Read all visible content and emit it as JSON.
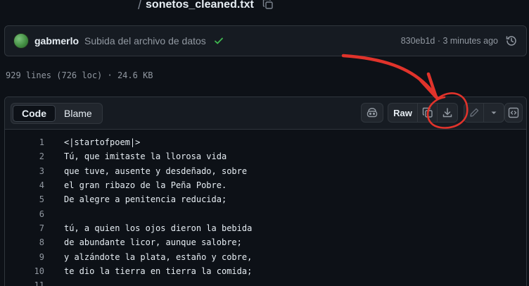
{
  "path": {
    "separator": "/",
    "file_name": "sonetos_cleaned.txt"
  },
  "commit": {
    "author": "gabmerlo",
    "message": "Subida del archivo de datos",
    "meta": "830eb1d · 3 minutes ago"
  },
  "file_stats": "929 lines (726 loc) · 24.6 KB",
  "toolbar": {
    "tabs": [
      {
        "label": "Code"
      },
      {
        "label": "Blame"
      }
    ],
    "raw_label": "Raw"
  },
  "annotation_color": "#e0332b",
  "code_lines": [
    {
      "n": "1",
      "text": "<|startofpoem|>"
    },
    {
      "n": "2",
      "text": "Tú, que imitaste la llorosa vida"
    },
    {
      "n": "3",
      "text": "que tuve, ausente y desdeñado, sobre"
    },
    {
      "n": "4",
      "text": "el gran ribazo de la Peña Pobre."
    },
    {
      "n": "5",
      "text": "De alegre a penitencia reducida;"
    },
    {
      "n": "6",
      "text": ""
    },
    {
      "n": "7",
      "text": "tú, a quien los ojos dieron la bebida"
    },
    {
      "n": "8",
      "text": "de abundante licor, aunque salobre;"
    },
    {
      "n": "9",
      "text": "y alzándote la plata, estaño y cobre,"
    },
    {
      "n": "10",
      "text": "te dio la tierra en tierra la comida;"
    },
    {
      "n": "11",
      "text": ""
    }
  ]
}
